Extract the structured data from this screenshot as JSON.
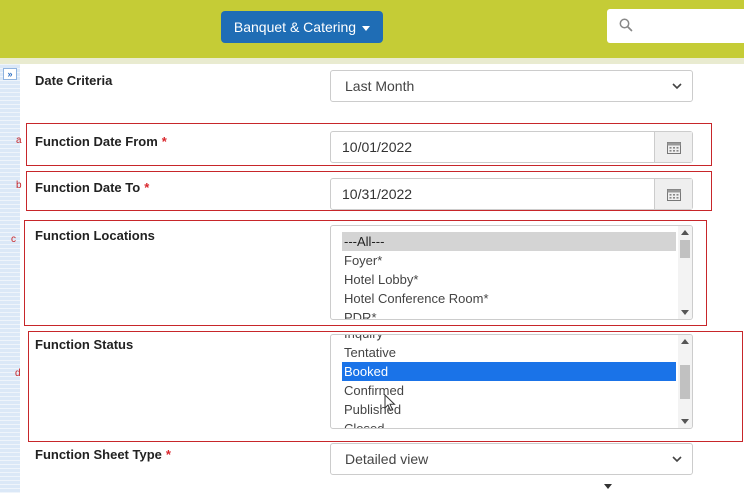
{
  "header": {
    "menu_label": "Banquet & Catering"
  },
  "form": {
    "date_criteria": {
      "label": "Date Criteria",
      "value": "Last Month"
    },
    "date_from": {
      "label": "Function Date From",
      "required": "*",
      "value": "10/01/2022"
    },
    "date_to": {
      "label": "Function Date To",
      "required": "*",
      "value": "10/31/2022"
    },
    "locations": {
      "label": "Function Locations",
      "options": [
        "---All---",
        "Foyer*",
        "Hotel Lobby*",
        "Hotel Conference Room*",
        "PDR*"
      ],
      "selected": "---All---"
    },
    "status": {
      "label": "Function Status",
      "options": [
        "Inquiry",
        "Tentative",
        "Booked",
        "Confirmed",
        "Published",
        "Closed"
      ],
      "selected": "Booked"
    },
    "sheet_type": {
      "label": "Function Sheet Type",
      "required": "*",
      "value": "Detailed view"
    }
  },
  "annotations": [
    "a",
    "b",
    "c",
    "d"
  ],
  "sidebar_toggle": "»",
  "colors": {
    "topbar": "#c5cc36",
    "button": "#1f6db5",
    "annotation": "#c7262a",
    "selected": "#1a73e8"
  },
  "icons": [
    "chevron-down-icon",
    "search-icon",
    "calendar-icon",
    "expand-icon",
    "cursor-icon"
  ]
}
